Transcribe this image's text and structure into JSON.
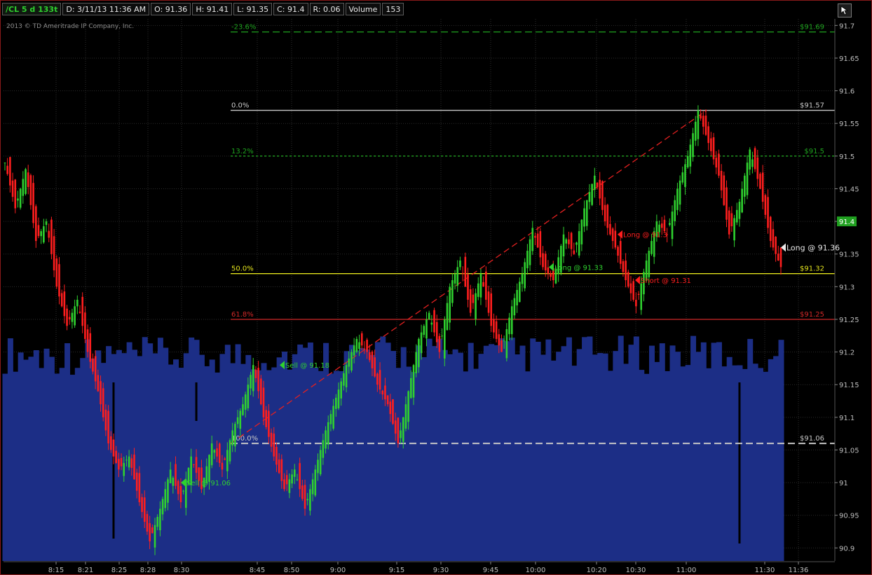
{
  "header": {
    "symbol": "/CL 5 d 133t",
    "date": "D: 3/11/13 11:36 AM",
    "open": "O: 91.36",
    "high": "H: 91.41",
    "low": "L: 91.35",
    "close": "C: 91.4",
    "range": "R: 0.06",
    "volume_label": "Volume",
    "volume_value": "153"
  },
  "copyright": "2013 © TD Ameritrade IP Company, Inc.",
  "colors": {
    "up": "#2fd12f",
    "down": "#ff1e1e",
    "volume": "#1c2e86",
    "fib_green": "#1fa31f",
    "fib_white": "#c8c8c8",
    "fib_yellow": "#e3e31d",
    "fib_red": "#d22828",
    "trend": "#e32020",
    "price_tag": "#20a020"
  },
  "chart_data": {
    "type": "candlestick",
    "y_axis": {
      "range": [
        90.88,
        91.71
      ],
      "ticks": [
        "91.7",
        "91.65",
        "91.6",
        "91.55",
        "91.5",
        "91.45",
        "91.4",
        "91.35",
        "91.3",
        "91.25",
        "91.2",
        "91.15",
        "91.1",
        "91.05",
        "91",
        "90.95",
        "90.9"
      ],
      "current_price_label": "91.4"
    },
    "x_axis": {
      "ticks": [
        "8:15",
        "8:21",
        "8:25",
        "8:28",
        "8:30",
        "8:45",
        "8:50",
        "9:00",
        "9:15",
        "9:30",
        "9:45",
        "10:00",
        "10:20",
        "10:30",
        "11:00",
        "11:30",
        "11:36"
      ]
    },
    "fib_levels": [
      {
        "pct": "-23.6%",
        "price": 91.69,
        "price_label": "$91.69",
        "style": "dashed",
        "color": "green"
      },
      {
        "pct": "0.0%",
        "price": 91.57,
        "price_label": "$91.57",
        "style": "solid",
        "color": "white"
      },
      {
        "pct": "13.2%",
        "price": 91.5,
        "price_label": "$91.5",
        "style": "dotted",
        "color": "green"
      },
      {
        "pct": "50.0%",
        "price": 91.32,
        "price_label": "$91.32",
        "style": "solid",
        "color": "yellow"
      },
      {
        "pct": "61.8%",
        "price": 91.25,
        "price_label": "$91.25",
        "style": "solid",
        "color": "red"
      },
      {
        "pct": "100.0%",
        "price": 91.06,
        "price_label": "$91.06",
        "style": "dashed",
        "color": "white"
      }
    ],
    "trendline": {
      "from_price": 91.06,
      "to_price": 91.57
    },
    "trades": [
      {
        "label": "Sell @ 91.06",
        "price": 91.0,
        "side": "sell"
      },
      {
        "label": "Sell @ 91.18",
        "price": 91.18,
        "side": "sell"
      },
      {
        "label": "Long @ 91.33",
        "price": 91.33,
        "side": "long"
      },
      {
        "label": "Long @ 91.3",
        "price": 91.38,
        "side": "exit"
      },
      {
        "label": "Short @ 91.31",
        "price": 91.31,
        "side": "short"
      },
      {
        "label": "Long @ 91.36",
        "price": 91.36,
        "side": "current"
      }
    ],
    "price_path": [
      [
        0,
        91.49
      ],
      [
        2,
        91.42
      ],
      [
        4,
        91.48
      ],
      [
        6,
        91.37
      ],
      [
        8,
        91.4
      ],
      [
        10,
        91.3
      ],
      [
        12,
        91.24
      ],
      [
        14,
        91.28
      ],
      [
        16,
        91.2
      ],
      [
        18,
        91.14
      ],
      [
        20,
        91.06
      ],
      [
        22,
        91.02
      ],
      [
        24,
        91.04
      ],
      [
        26,
        90.97
      ],
      [
        28,
        90.91
      ],
      [
        30,
        90.96
      ],
      [
        32,
        91.02
      ],
      [
        34,
        90.97
      ],
      [
        36,
        91.04
      ],
      [
        38,
        90.99
      ],
      [
        40,
        91.06
      ],
      [
        42,
        91.02
      ],
      [
        44,
        91.08
      ],
      [
        46,
        91.12
      ],
      [
        48,
        91.18
      ],
      [
        50,
        91.1
      ],
      [
        52,
        91.04
      ],
      [
        54,
        90.99
      ],
      [
        56,
        91.02
      ],
      [
        58,
        90.96
      ],
      [
        60,
        91.02
      ],
      [
        62,
        91.08
      ],
      [
        64,
        91.13
      ],
      [
        66,
        91.18
      ],
      [
        68,
        91.22
      ],
      [
        70,
        91.2
      ],
      [
        72,
        91.15
      ],
      [
        74,
        91.12
      ],
      [
        76,
        91.06
      ],
      [
        78,
        91.14
      ],
      [
        80,
        91.22
      ],
      [
        82,
        91.26
      ],
      [
        84,
        91.2
      ],
      [
        86,
        91.3
      ],
      [
        88,
        91.34
      ],
      [
        90,
        91.26
      ],
      [
        92,
        91.32
      ],
      [
        94,
        91.24
      ],
      [
        96,
        91.2
      ],
      [
        98,
        91.27
      ],
      [
        100,
        91.32
      ],
      [
        102,
        91.39
      ],
      [
        104,
        91.33
      ],
      [
        106,
        91.31
      ],
      [
        108,
        91.38
      ],
      [
        110,
        91.35
      ],
      [
        112,
        91.42
      ],
      [
        114,
        91.47
      ],
      [
        116,
        91.4
      ],
      [
        118,
        91.36
      ],
      [
        120,
        91.31
      ],
      [
        122,
        91.27
      ],
      [
        124,
        91.34
      ],
      [
        126,
        91.4
      ],
      [
        128,
        91.38
      ],
      [
        130,
        91.45
      ],
      [
        132,
        91.5
      ],
      [
        134,
        91.57
      ],
      [
        136,
        91.52
      ],
      [
        138,
        91.47
      ],
      [
        140,
        91.38
      ],
      [
        142,
        91.43
      ],
      [
        144,
        91.51
      ],
      [
        146,
        91.45
      ],
      [
        148,
        91.37
      ],
      [
        150,
        91.33
      ]
    ],
    "volume_profile": [
      [
        0,
        0.62
      ],
      [
        10,
        0.55
      ],
      [
        20,
        0.5
      ],
      [
        30,
        0.48
      ],
      [
        40,
        0.52
      ],
      [
        50,
        0.55
      ],
      [
        60,
        0.58
      ],
      [
        70,
        0.6
      ],
      [
        80,
        0.62
      ],
      [
        90,
        0.58
      ],
      [
        100,
        0.6
      ],
      [
        110,
        0.62
      ],
      [
        120,
        0.59
      ],
      [
        130,
        0.63
      ],
      [
        140,
        0.6
      ],
      [
        150,
        0.55
      ]
    ]
  }
}
